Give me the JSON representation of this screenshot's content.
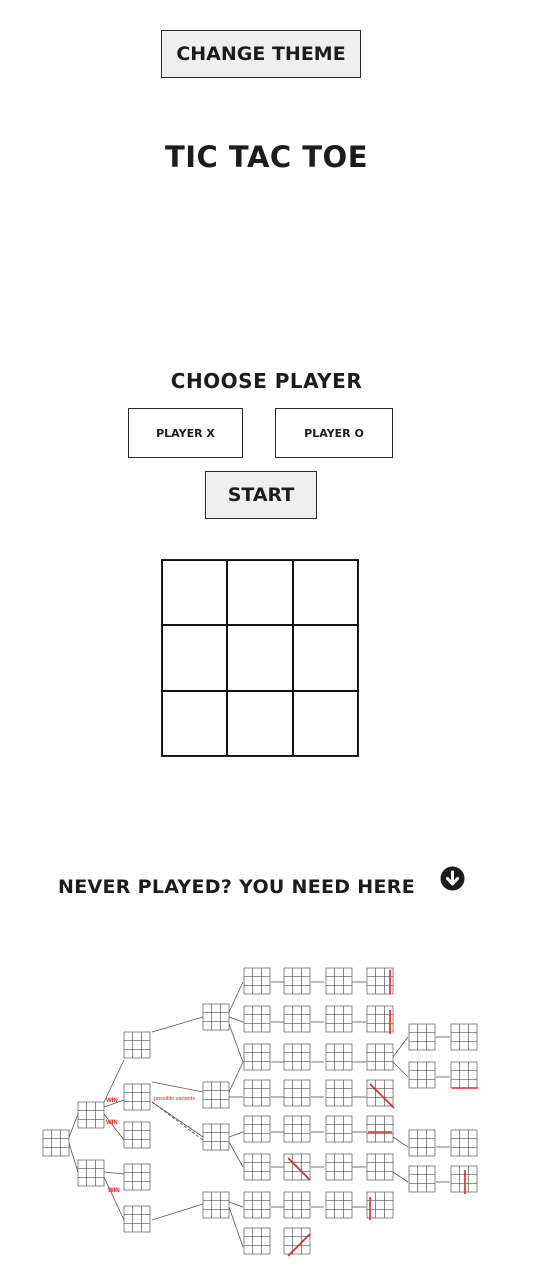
{
  "header": {
    "change_theme_label": "CHANGE THEME"
  },
  "game": {
    "title": "TIC TAC TOE",
    "choose_player_heading": "CHOOSE PLAYER",
    "player_x_label": "PLAYER X",
    "player_o_label": "PLAYER O",
    "start_label": "START",
    "board": [
      "",
      "",
      "",
      "",
      "",
      "",
      "",
      "",
      ""
    ]
  },
  "help": {
    "heading": "NEVER PLAYED? YOU NEED HERE",
    "icon": "arrow-down-circle-icon",
    "tree_labels": {
      "win": "WIN",
      "possible_variants": "possible variants"
    }
  },
  "colors": {
    "text": "#1c1c1c",
    "button_bg": "#efefef",
    "accent_red": "#e8202a"
  }
}
